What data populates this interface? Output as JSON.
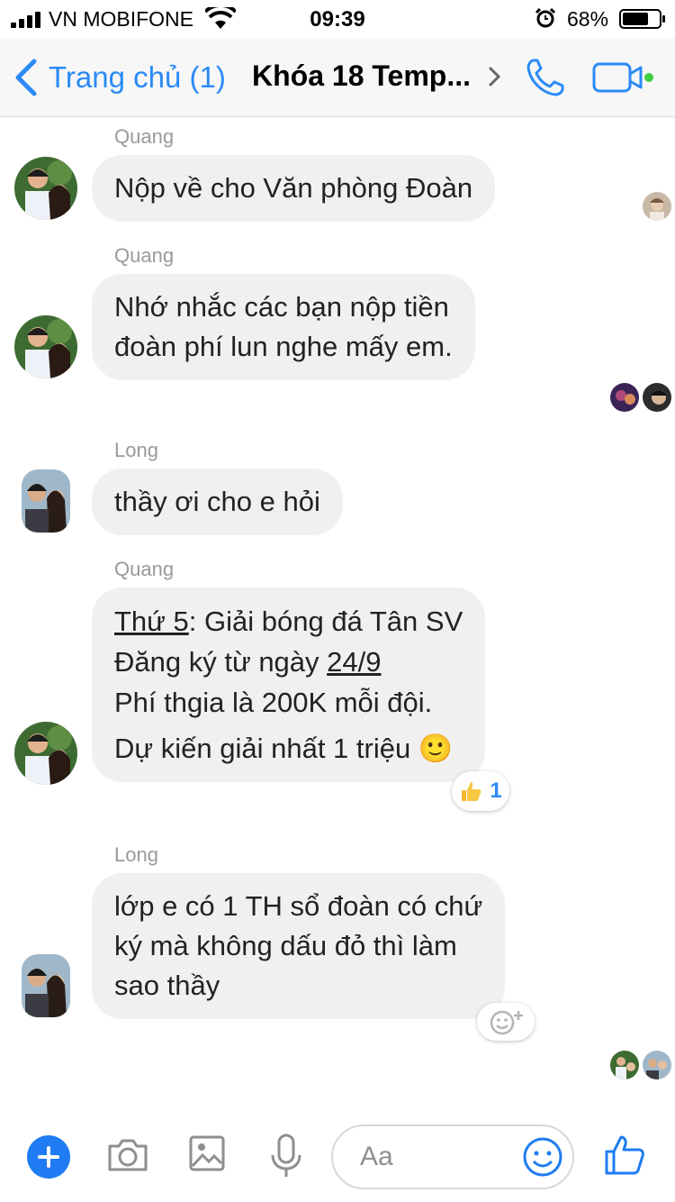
{
  "status_bar": {
    "carrier": "VN MOBIFONE",
    "time": "09:39",
    "battery": "68%"
  },
  "header": {
    "back_label": "Trang chủ (1)",
    "title": "Khóa 18 Temp..."
  },
  "messages": [
    {
      "sender": "Quang",
      "lines": [
        "Nộp về cho Văn phòng Đoàn"
      ]
    },
    {
      "sender": "Quang",
      "lines": [
        "Nhớ nhắc các bạn nộp tiền",
        "đoàn phí lun nghe mấy em."
      ]
    },
    {
      "sender": "Long",
      "lines": [
        "thầy ơi cho e hỏi"
      ]
    },
    {
      "sender": "Quang",
      "line1_underlined": "Thứ 5",
      "line1_rest": ": Giải bóng đá Tân SV",
      "line2_prefix": "Đăng ký từ ngày ",
      "line2_underlined": "24/9",
      "line3": "Phí thgia là 200K mỗi đội.",
      "line4": "Dự kiến giải nhất 1 triệu 🙂",
      "reaction_count": "1"
    },
    {
      "sender": "Long",
      "lines": [
        "lớp e có 1 TH sổ đoàn có chứ",
        "ký mà không dấu đỏ thì làm",
        "sao thầy"
      ]
    }
  ],
  "composer": {
    "placeholder": "Aa"
  },
  "colors": {
    "accent": "#1f7cf2",
    "bubble": "#f1f0f0",
    "online": "#3fd03f"
  },
  "icons": [
    "back-chevron-icon",
    "phone-icon",
    "video-camera-icon",
    "plus-icon",
    "camera-icon",
    "image-icon",
    "microphone-icon",
    "smiley-icon",
    "thumbs-up-icon"
  ]
}
